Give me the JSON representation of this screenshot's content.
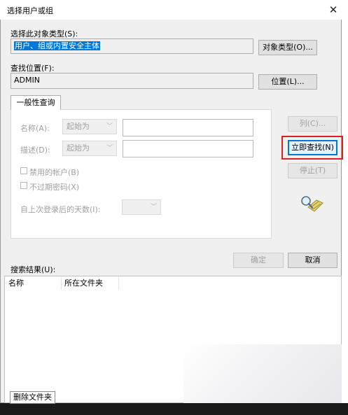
{
  "dialog": {
    "title": "选择用户或组",
    "object_type": {
      "label": "选择此对象类型(S):",
      "value": "用户、组或内置安全主体",
      "button": "对象类型(O)..."
    },
    "location": {
      "label": "查找位置(F):",
      "value": "ADMIN",
      "button": "位置(L)..."
    },
    "tab": "一般性查询",
    "query": {
      "name_label": "名称(A):",
      "name_mode": "起始为",
      "desc_label": "描述(D):",
      "desc_mode": "起始为",
      "disabled_accounts": "禁用的帐户(B)",
      "non_expiring": "不过期密码(X)",
      "days_label": "自上次登录后的天数(I):"
    },
    "buttons": {
      "columns": "列(C)...",
      "find_now": "立即查找(N)",
      "stop": "停止(T)",
      "ok": "确定",
      "cancel": "取消"
    },
    "results": {
      "label": "搜索结果(U):",
      "columns": [
        "名称",
        "所在文件夹"
      ]
    }
  },
  "background": {
    "delete_folder": "删除文件夹"
  },
  "colors": {
    "accent": "#0078d7",
    "highlight": "#e02020"
  }
}
